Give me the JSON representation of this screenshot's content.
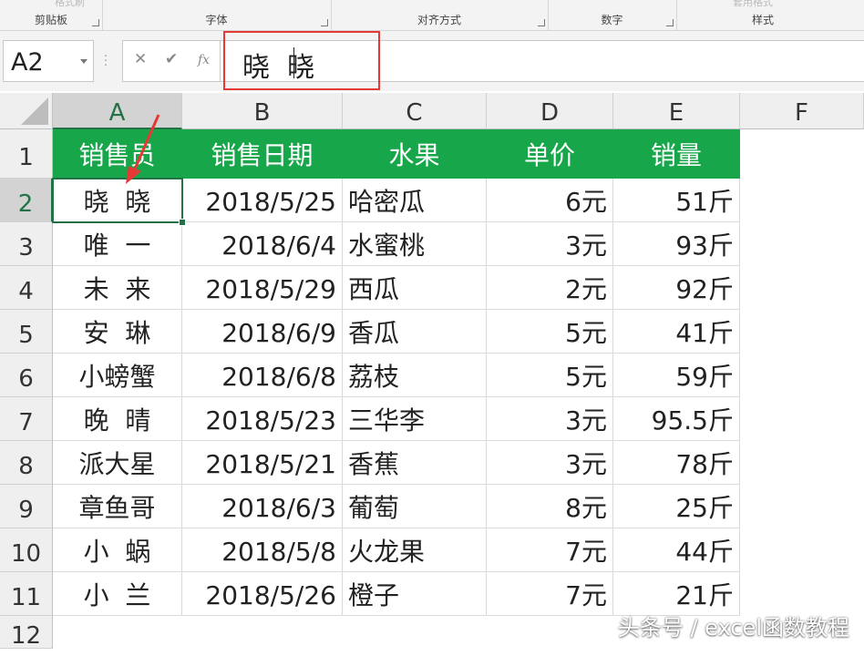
{
  "ribbon": {
    "groups": [
      {
        "label": "剪贴板"
      },
      {
        "label": "字体"
      },
      {
        "label": "对齐方式"
      },
      {
        "label": "数字"
      },
      {
        "label": "样式"
      }
    ],
    "ghost_format_painter": "格式刷",
    "ghost_table_format": "套用格式"
  },
  "formula_bar": {
    "name_box": "A2",
    "cancel_icon": "✕",
    "enter_icon": "✔",
    "function_label": "fx",
    "value": "晓  晓"
  },
  "columns": [
    "A",
    "B",
    "C",
    "D",
    "E",
    "F"
  ],
  "rows": [
    "1",
    "2",
    "3",
    "4",
    "5",
    "6",
    "7",
    "8",
    "9",
    "10",
    "11",
    "12"
  ],
  "header": [
    "销售员",
    "销售日期",
    "水果",
    "单价",
    "销量"
  ],
  "data": [
    [
      "晓  晓",
      "2018/5/25",
      "哈密瓜",
      "6元",
      "51斤"
    ],
    [
      "唯  一",
      "2018/6/4",
      "水蜜桃",
      "3元",
      "93斤"
    ],
    [
      "未  来",
      "2018/5/29",
      "西瓜",
      "2元",
      "92斤"
    ],
    [
      "安  琳",
      "2018/6/9",
      "香瓜",
      "5元",
      "41斤"
    ],
    [
      "小螃蟹",
      "2018/6/8",
      "荔枝",
      "5元",
      "59斤"
    ],
    [
      "晚  晴",
      "2018/5/23",
      "三华李",
      "3元",
      "95.5斤"
    ],
    [
      "派大星",
      "2018/5/21",
      "香蕉",
      "3元",
      "78斤"
    ],
    [
      "章鱼哥",
      "2018/6/3",
      "葡萄",
      "8元",
      "25斤"
    ],
    [
      "小  蜗",
      "2018/5/8",
      "火龙果",
      "7元",
      "44斤"
    ],
    [
      "小  兰",
      "2018/5/26",
      "橙子",
      "7元",
      "21斤"
    ]
  ],
  "watermark": "头条号 / excel函数教程",
  "colors": {
    "header_fill": "#18a64b",
    "selection": "#217346",
    "highlight_box": "#e53935",
    "arrow": "#e53935"
  }
}
